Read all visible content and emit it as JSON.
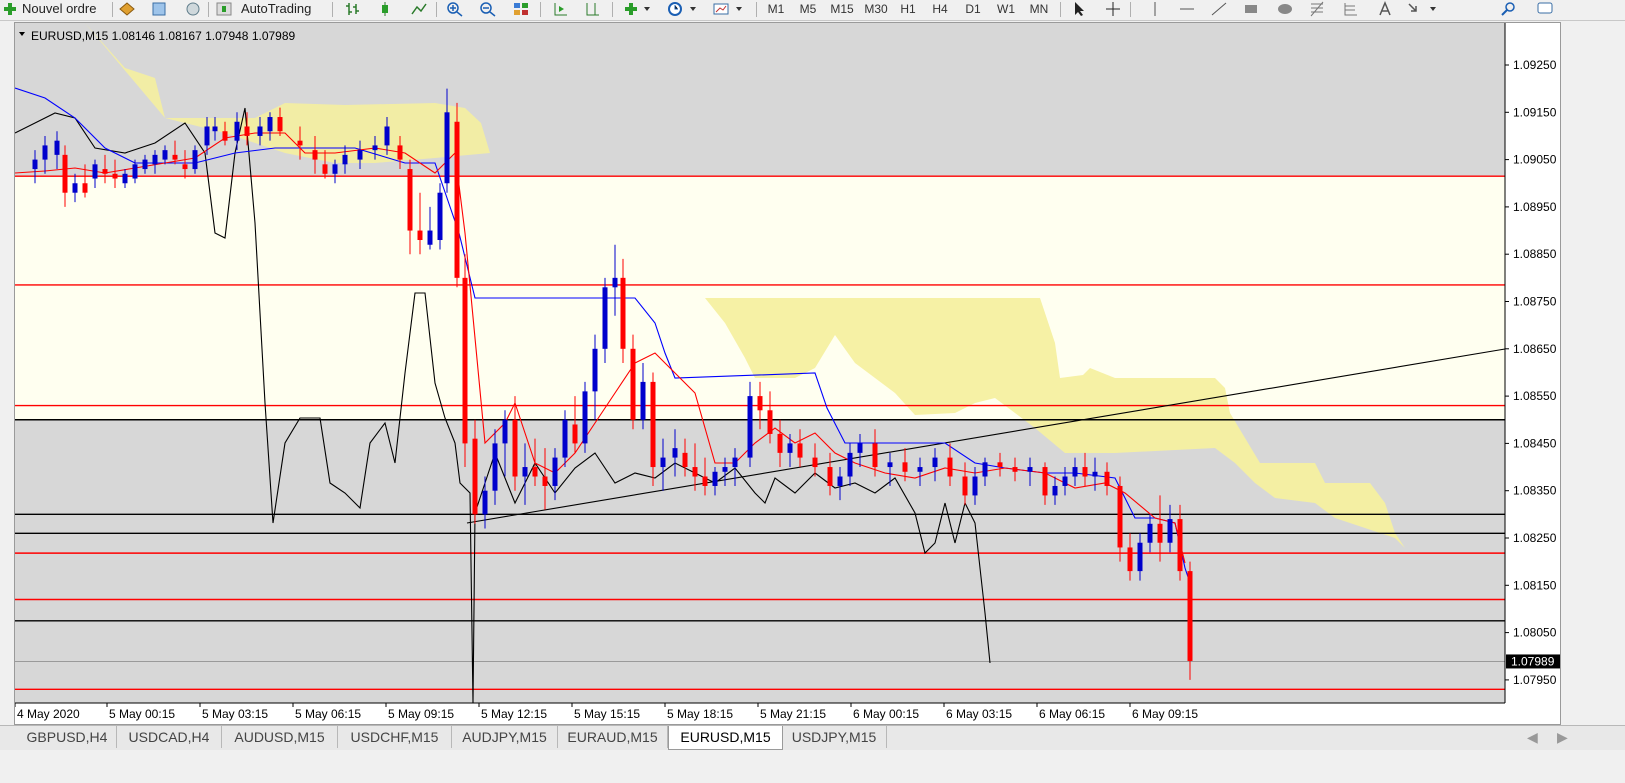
{
  "toolbar": {
    "new_order_label": "Nouvel ordre",
    "autotrading_label": "AutoTrading",
    "timeframes": [
      "M1",
      "M5",
      "M15",
      "M30",
      "H1",
      "H4",
      "D1",
      "W1",
      "MN"
    ]
  },
  "chart": {
    "symbol_header": "EURUSD,M15  1.08146 1.08167 1.07948 1.07989",
    "price_axis": [
      "1.09250",
      "1.09150",
      "1.09050",
      "1.08950",
      "1.08850",
      "1.08750",
      "1.08650",
      "1.08550",
      "1.08450",
      "1.08350",
      "1.08250",
      "1.08150",
      "1.08050",
      "1.07950"
    ],
    "current_price": "1.07989",
    "time_axis": [
      "4 May 2020",
      "5 May 00:15",
      "5 May 03:15",
      "5 May 06:15",
      "5 May 09:15",
      "5 May 12:15",
      "5 May 15:15",
      "5 May 18:15",
      "5 May 21:15",
      "6 May 00:15",
      "6 May 03:15",
      "6 May 06:15",
      "6 May 09:15"
    ],
    "colors": {
      "bull": "#0000cc",
      "bear": "#ff0000",
      "cloud": "#f5f0a0",
      "tenkan": "#ff0000",
      "kijun": "#0000ff",
      "chikou": "#000000",
      "level_red": "#ff0000",
      "level_black": "#000000"
    }
  },
  "tabs": [
    "GBPUSD,H4",
    "USDCAD,H4",
    "AUDUSD,M15",
    "USDCHF,M15",
    "AUDJPY,M15",
    "EURAUD,M15",
    "EURUSD,M15",
    "USDJPY,M15"
  ],
  "active_tab": "EURUSD,M15"
}
